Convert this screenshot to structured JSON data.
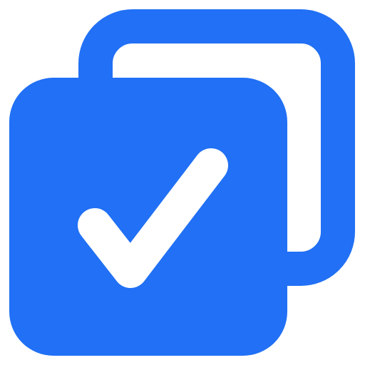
{
  "icon": {
    "name": "copy-check-icon",
    "color": "#2170F5",
    "background": "#FFFFFF"
  }
}
